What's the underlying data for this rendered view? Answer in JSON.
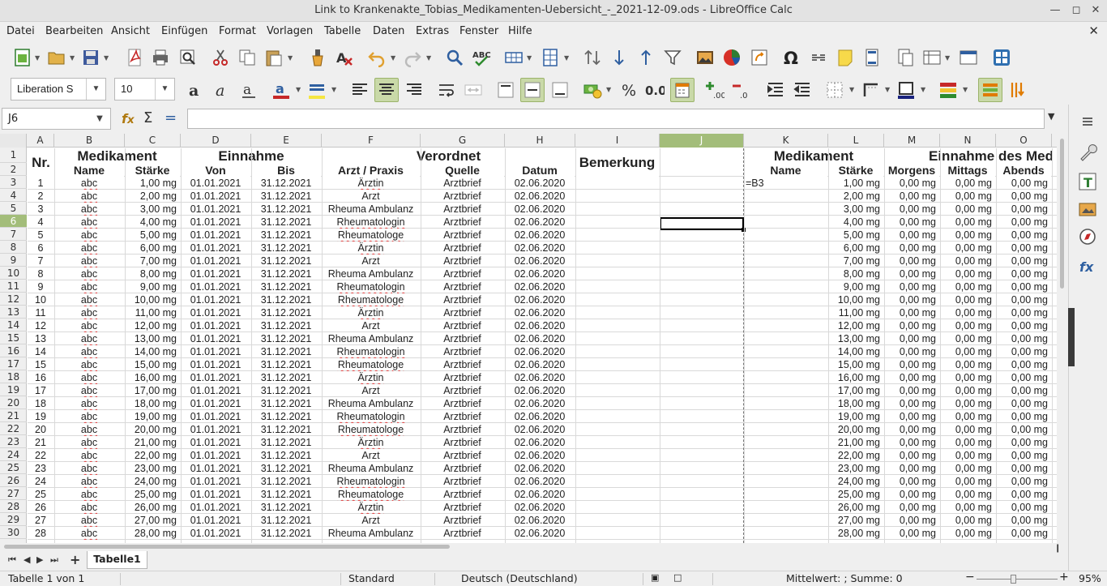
{
  "window": {
    "title": "Link to Krankenakte_Tobias_Medikamenten-Uebersicht_-_2021-12-09.ods - LibreOffice Calc"
  },
  "menu": [
    "Datei",
    "Bearbeiten",
    "Ansicht",
    "Einfügen",
    "Format",
    "Vorlagen",
    "Tabelle",
    "Daten",
    "Extras",
    "Fenster",
    "Hilfe"
  ],
  "format": {
    "font_name": "Liberation S",
    "font_size": "10"
  },
  "formula": {
    "cell_ref": "J6",
    "content": ""
  },
  "columns": [
    "A",
    "B",
    "C",
    "D",
    "E",
    "F",
    "G",
    "H",
    "I",
    "J",
    "K",
    "L",
    "M",
    "N",
    "O"
  ],
  "selected_column": "J",
  "selected_row": 6,
  "header": {
    "nr": "Nr.",
    "medikament": "Medikament",
    "einnahme": "Einnahme",
    "verordnet": "Verordnet",
    "bemerkung": "Bemerkung",
    "medikament2": "Medikament",
    "einnahme_des": "Einnahme des Med",
    "sub": {
      "name": "Name",
      "staerke": "Stärke",
      "von": "Von",
      "bis": "Bis",
      "arzt": "Arzt / Praxis",
      "quelle": "Quelle",
      "datum": "Datum",
      "name2": "Name",
      "staerke2": "Stärke",
      "morgens": "Morgens",
      "mittags": "Mittags",
      "abends": "Abends"
    }
  },
  "formula_cell_k3": "=B3",
  "rows": [
    {
      "row": 3,
      "nr": "1",
      "name": "abc",
      "staerke": "1,00 mg",
      "von": "01.01.2021",
      "bis": "31.12.2021",
      "arzt": "Ärztin",
      "quelle": "Arztbrief",
      "datum": "02.06.2020",
      "l": "1,00 mg",
      "m": "0,00 mg",
      "n": "0,00 mg",
      "o": "0,00 mg"
    },
    {
      "row": 4,
      "nr": "2",
      "name": "abc",
      "staerke": "2,00 mg",
      "von": "01.01.2021",
      "bis": "31.12.2021",
      "arzt": "Arzt",
      "quelle": "Arztbrief",
      "datum": "02.06.2020",
      "l": "2,00 mg",
      "m": "0,00 mg",
      "n": "0,00 mg",
      "o": "0,00 mg"
    },
    {
      "row": 5,
      "nr": "3",
      "name": "abc",
      "staerke": "3,00 mg",
      "von": "01.01.2021",
      "bis": "31.12.2021",
      "arzt": "Rheuma Ambulanz",
      "quelle": "Arztbrief",
      "datum": "02.06.2020",
      "l": "3,00 mg",
      "m": "0,00 mg",
      "n": "0,00 mg",
      "o": "0,00 mg"
    },
    {
      "row": 6,
      "nr": "4",
      "name": "abc",
      "staerke": "4,00 mg",
      "von": "01.01.2021",
      "bis": "31.12.2021",
      "arzt": "Rheumatologin",
      "quelle": "Arztbrief",
      "datum": "02.06.2020",
      "l": "4,00 mg",
      "m": "0,00 mg",
      "n": "0,00 mg",
      "o": "0,00 mg"
    },
    {
      "row": 7,
      "nr": "5",
      "name": "abc",
      "staerke": "5,00 mg",
      "von": "01.01.2021",
      "bis": "31.12.2021",
      "arzt": "Rheumatologe",
      "quelle": "Arztbrief",
      "datum": "02.06.2020",
      "l": "5,00 mg",
      "m": "0,00 mg",
      "n": "0,00 mg",
      "o": "0,00 mg"
    },
    {
      "row": 8,
      "nr": "6",
      "name": "abc",
      "staerke": "6,00 mg",
      "von": "01.01.2021",
      "bis": "31.12.2021",
      "arzt": "Ärztin",
      "quelle": "Arztbrief",
      "datum": "02.06.2020",
      "l": "6,00 mg",
      "m": "0,00 mg",
      "n": "0,00 mg",
      "o": "0,00 mg"
    },
    {
      "row": 9,
      "nr": "7",
      "name": "abc",
      "staerke": "7,00 mg",
      "von": "01.01.2021",
      "bis": "31.12.2021",
      "arzt": "Arzt",
      "quelle": "Arztbrief",
      "datum": "02.06.2020",
      "l": "7,00 mg",
      "m": "0,00 mg",
      "n": "0,00 mg",
      "o": "0,00 mg"
    },
    {
      "row": 10,
      "nr": "8",
      "name": "abc",
      "staerke": "8,00 mg",
      "von": "01.01.2021",
      "bis": "31.12.2021",
      "arzt": "Rheuma Ambulanz",
      "quelle": "Arztbrief",
      "datum": "02.06.2020",
      "l": "8,00 mg",
      "m": "0,00 mg",
      "n": "0,00 mg",
      "o": "0,00 mg"
    },
    {
      "row": 11,
      "nr": "9",
      "name": "abc",
      "staerke": "9,00 mg",
      "von": "01.01.2021",
      "bis": "31.12.2021",
      "arzt": "Rheumatologin",
      "quelle": "Arztbrief",
      "datum": "02.06.2020",
      "l": "9,00 mg",
      "m": "0,00 mg",
      "n": "0,00 mg",
      "o": "0,00 mg"
    },
    {
      "row": 12,
      "nr": "10",
      "name": "abc",
      "staerke": "10,00 mg",
      "von": "01.01.2021",
      "bis": "31.12.2021",
      "arzt": "Rheumatologe",
      "quelle": "Arztbrief",
      "datum": "02.06.2020",
      "l": "10,00 mg",
      "m": "0,00 mg",
      "n": "0,00 mg",
      "o": "0,00 mg"
    },
    {
      "row": 13,
      "nr": "11",
      "name": "abc",
      "staerke": "11,00 mg",
      "von": "01.01.2021",
      "bis": "31.12.2021",
      "arzt": "Ärztin",
      "quelle": "Arztbrief",
      "datum": "02.06.2020",
      "l": "11,00 mg",
      "m": "0,00 mg",
      "n": "0,00 mg",
      "o": "0,00 mg"
    },
    {
      "row": 14,
      "nr": "12",
      "name": "abc",
      "staerke": "12,00 mg",
      "von": "01.01.2021",
      "bis": "31.12.2021",
      "arzt": "Arzt",
      "quelle": "Arztbrief",
      "datum": "02.06.2020",
      "l": "12,00 mg",
      "m": "0,00 mg",
      "n": "0,00 mg",
      "o": "0,00 mg"
    },
    {
      "row": 15,
      "nr": "13",
      "name": "abc",
      "staerke": "13,00 mg",
      "von": "01.01.2021",
      "bis": "31.12.2021",
      "arzt": "Rheuma Ambulanz",
      "quelle": "Arztbrief",
      "datum": "02.06.2020",
      "l": "13,00 mg",
      "m": "0,00 mg",
      "n": "0,00 mg",
      "o": "0,00 mg"
    },
    {
      "row": 16,
      "nr": "14",
      "name": "abc",
      "staerke": "14,00 mg",
      "von": "01.01.2021",
      "bis": "31.12.2021",
      "arzt": "Rheumatologin",
      "quelle": "Arztbrief",
      "datum": "02.06.2020",
      "l": "14,00 mg",
      "m": "0,00 mg",
      "n": "0,00 mg",
      "o": "0,00 mg"
    },
    {
      "row": 17,
      "nr": "15",
      "name": "abc",
      "staerke": "15,00 mg",
      "von": "01.01.2021",
      "bis": "31.12.2021",
      "arzt": "Rheumatologe",
      "quelle": "Arztbrief",
      "datum": "02.06.2020",
      "l": "15,00 mg",
      "m": "0,00 mg",
      "n": "0,00 mg",
      "o": "0,00 mg"
    },
    {
      "row": 18,
      "nr": "16",
      "name": "abc",
      "staerke": "16,00 mg",
      "von": "01.01.2021",
      "bis": "31.12.2021",
      "arzt": "Ärztin",
      "quelle": "Arztbrief",
      "datum": "02.06.2020",
      "l": "16,00 mg",
      "m": "0,00 mg",
      "n": "0,00 mg",
      "o": "0,00 mg"
    },
    {
      "row": 19,
      "nr": "17",
      "name": "abc",
      "staerke": "17,00 mg",
      "von": "01.01.2021",
      "bis": "31.12.2021",
      "arzt": "Arzt",
      "quelle": "Arztbrief",
      "datum": "02.06.2020",
      "l": "17,00 mg",
      "m": "0,00 mg",
      "n": "0,00 mg",
      "o": "0,00 mg"
    },
    {
      "row": 20,
      "nr": "18",
      "name": "abc",
      "staerke": "18,00 mg",
      "von": "01.01.2021",
      "bis": "31.12.2021",
      "arzt": "Rheuma Ambulanz",
      "quelle": "Arztbrief",
      "datum": "02.06.2020",
      "l": "18,00 mg",
      "m": "0,00 mg",
      "n": "0,00 mg",
      "o": "0,00 mg"
    },
    {
      "row": 21,
      "nr": "19",
      "name": "abc",
      "staerke": "19,00 mg",
      "von": "01.01.2021",
      "bis": "31.12.2021",
      "arzt": "Rheumatologin",
      "quelle": "Arztbrief",
      "datum": "02.06.2020",
      "l": "19,00 mg",
      "m": "0,00 mg",
      "n": "0,00 mg",
      "o": "0,00 mg"
    },
    {
      "row": 22,
      "nr": "20",
      "name": "abc",
      "staerke": "20,00 mg",
      "von": "01.01.2021",
      "bis": "31.12.2021",
      "arzt": "Rheumatologe",
      "quelle": "Arztbrief",
      "datum": "02.06.2020",
      "l": "20,00 mg",
      "m": "0,00 mg",
      "n": "0,00 mg",
      "o": "0,00 mg"
    },
    {
      "row": 23,
      "nr": "21",
      "name": "abc",
      "staerke": "21,00 mg",
      "von": "01.01.2021",
      "bis": "31.12.2021",
      "arzt": "Ärztin",
      "quelle": "Arztbrief",
      "datum": "02.06.2020",
      "l": "21,00 mg",
      "m": "0,00 mg",
      "n": "0,00 mg",
      "o": "0,00 mg"
    },
    {
      "row": 24,
      "nr": "22",
      "name": "abc",
      "staerke": "22,00 mg",
      "von": "01.01.2021",
      "bis": "31.12.2021",
      "arzt": "Arzt",
      "quelle": "Arztbrief",
      "datum": "02.06.2020",
      "l": "22,00 mg",
      "m": "0,00 mg",
      "n": "0,00 mg",
      "o": "0,00 mg"
    },
    {
      "row": 25,
      "nr": "23",
      "name": "abc",
      "staerke": "23,00 mg",
      "von": "01.01.2021",
      "bis": "31.12.2021",
      "arzt": "Rheuma Ambulanz",
      "quelle": "Arztbrief",
      "datum": "02.06.2020",
      "l": "23,00 mg",
      "m": "0,00 mg",
      "n": "0,00 mg",
      "o": "0,00 mg"
    },
    {
      "row": 26,
      "nr": "24",
      "name": "abc",
      "staerke": "24,00 mg",
      "von": "01.01.2021",
      "bis": "31.12.2021",
      "arzt": "Rheumatologin",
      "quelle": "Arztbrief",
      "datum": "02.06.2020",
      "l": "24,00 mg",
      "m": "0,00 mg",
      "n": "0,00 mg",
      "o": "0,00 mg"
    },
    {
      "row": 27,
      "nr": "25",
      "name": "abc",
      "staerke": "25,00 mg",
      "von": "01.01.2021",
      "bis": "31.12.2021",
      "arzt": "Rheumatologe",
      "quelle": "Arztbrief",
      "datum": "02.06.2020",
      "l": "25,00 mg",
      "m": "0,00 mg",
      "n": "0,00 mg",
      "o": "0,00 mg"
    },
    {
      "row": 28,
      "nr": "26",
      "name": "abc",
      "staerke": "26,00 mg",
      "von": "01.01.2021",
      "bis": "31.12.2021",
      "arzt": "Ärztin",
      "quelle": "Arztbrief",
      "datum": "02.06.2020",
      "l": "26,00 mg",
      "m": "0,00 mg",
      "n": "0,00 mg",
      "o": "0,00 mg"
    },
    {
      "row": 29,
      "nr": "27",
      "name": "abc",
      "staerke": "27,00 mg",
      "von": "01.01.2021",
      "bis": "31.12.2021",
      "arzt": "Arzt",
      "quelle": "Arztbrief",
      "datum": "02.06.2020",
      "l": "27,00 mg",
      "m": "0,00 mg",
      "n": "0,00 mg",
      "o": "0,00 mg"
    },
    {
      "row": 30,
      "nr": "28",
      "name": "abc",
      "staerke": "28,00 mg",
      "von": "01.01.2021",
      "bis": "31.12.2021",
      "arzt": "Rheuma Ambulanz",
      "quelle": "Arztbrief",
      "datum": "02.06.2020",
      "l": "28,00 mg",
      "m": "0,00 mg",
      "n": "0,00 mg",
      "o": "0,00 mg"
    }
  ],
  "sheet_tabs": [
    "Tabelle1"
  ],
  "status": {
    "sheet": "Tabelle 1 von 1",
    "style": "Standard",
    "language": "Deutsch (Deutschland)",
    "summary": "Mittelwert: ; Summe: 0",
    "zoom": "95%"
  },
  "colors": {
    "selection": "#a3bd7a",
    "accent_green": "#c9d9a8"
  }
}
